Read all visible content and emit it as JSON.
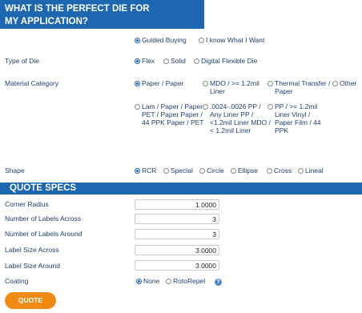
{
  "header": {
    "title_line1": "WHAT IS THE PERFECT DIE FOR",
    "title_line2": "MY APPLICATION?"
  },
  "mode": {
    "options": [
      "Guided Buying",
      "I know What I Want"
    ],
    "selected": "Guided Buying"
  },
  "die_type": {
    "label": "Type of Die",
    "options": [
      "Flex",
      "Solid",
      "Digital Flexible Die"
    ],
    "selected": "Flex"
  },
  "material": {
    "label": "Material Category",
    "options": [
      "Paper / Paper",
      "MDO / >= 1.2mil Liner",
      "Thermal Transfer / Paper",
      "Other",
      "Lam / Paper / Paper PET / Paper Paper / 44 PPK Paper / PET",
      ".0024-.0026 PP / Any Liner PP / <1.2mil Liner MDO / < 1.2mil Liner",
      "PP / >= 1.2mil Liner Vinyl / Paper Film / 44 PPK"
    ],
    "selected": "Paper / Paper"
  },
  "shape": {
    "label": "Shape",
    "options": [
      "RCR",
      "Special",
      "Circle",
      "Ellipse",
      "Cross",
      "Lineal"
    ],
    "selected": "RCR"
  },
  "quote_specs": {
    "title": "QUOTE SPECS",
    "fields": [
      {
        "label": "Corner Radius",
        "value": "1.0000"
      },
      {
        "label": "Number of Labels Across",
        "value": "3"
      },
      {
        "label": "Number of Labels Around",
        "value": "3"
      },
      {
        "label": "Label Size Across",
        "value": "3.0000"
      },
      {
        "label": "Label Size Around",
        "value": "3.0000"
      }
    ],
    "coating": {
      "label": "Coating",
      "options": [
        "None",
        "RotoRepel"
      ],
      "selected": "None",
      "help_icon": "question-icon"
    }
  },
  "buttons": {
    "quote": "QUOTE"
  },
  "colors": {
    "header_blue": "#1c67b0",
    "button_orange": "#ef8b14",
    "label_text": "#1f3f6e"
  }
}
